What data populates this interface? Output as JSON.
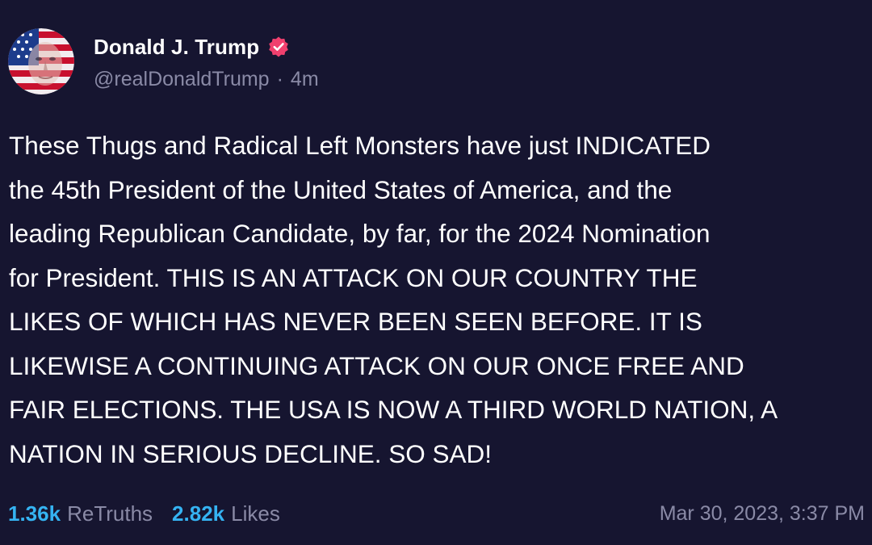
{
  "author": {
    "display_name": "Donald J. Trump",
    "handle": "@realDonaldTrump",
    "separator": "·",
    "time_ago": "4m",
    "verified_icon": "verified-badge-icon",
    "avatar_icon": "flag-face-avatar"
  },
  "post": {
    "text": "These Thugs and Radical Left Monsters have just INDICATED\nthe 45th President of the United States of America, and the\nleading Republican Candidate, by far, for the 2024 Nomination\nfor President. THIS IS AN ATTACK ON OUR COUNTRY THE\nLIKES OF WHICH HAS NEVER BEEN SEEN BEFORE. IT IS\nLIKEWISE A CONTINUING ATTACK ON OUR ONCE FREE AND\nFAIR ELECTIONS. THE USA IS NOW A THIRD WORLD NATION, A\nNATION IN SERIOUS DECLINE. SO SAD!"
  },
  "stats": {
    "retruths_count": "1.36k",
    "retruths_label": "ReTruths",
    "likes_count": "2.82k",
    "likes_label": "Likes"
  },
  "timestamp": "Mar 30, 2023, 3:37 PM",
  "colors": {
    "background": "#161530",
    "accent": "#35b3f2",
    "muted": "#8a8aa6",
    "badge": "#f0406e"
  }
}
